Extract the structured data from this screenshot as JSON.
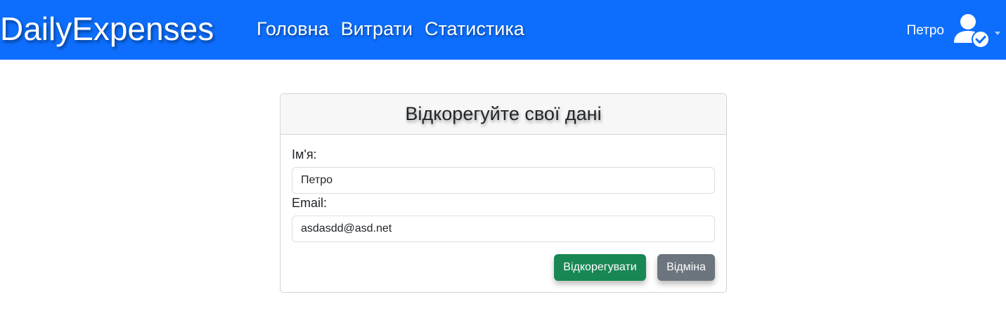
{
  "navbar": {
    "brand": "DailyExpenses",
    "links": [
      "Головна",
      "Витрати",
      "Статистика"
    ],
    "user_name": "Петро",
    "user_icon": "user-check-icon",
    "colors": {
      "background": "#0d6efd",
      "text": "#ffffff"
    }
  },
  "form": {
    "title": "Відкорегуйте свої дані",
    "name_label": "Ім'я:",
    "name_value": "Петро",
    "email_label": "Email:",
    "email_value": "asdasdd@asd.net",
    "submit_label": "Відкорегувати",
    "cancel_label": "Відміна",
    "colors": {
      "submit": "#198754",
      "cancel": "#6c757d"
    }
  }
}
